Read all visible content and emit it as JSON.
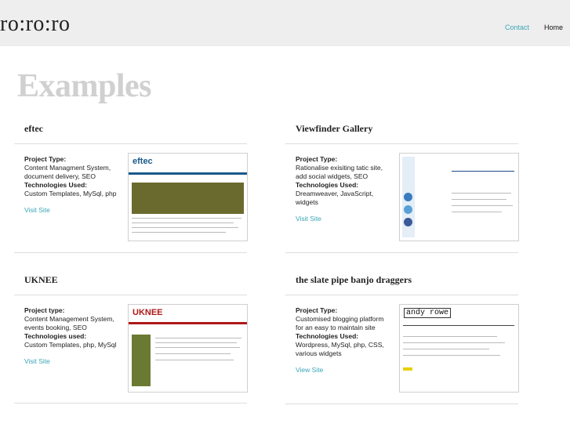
{
  "header": {
    "logo": "ro:ro:ro",
    "nav": {
      "contact": "Contact",
      "home": "Home"
    }
  },
  "page_title": "Examples",
  "projects": [
    {
      "title": "eftec",
      "type_label": "Project Type:",
      "type": "Content Managment System, document delivery, SEO",
      "tech_label": "Technologies Used:",
      "tech": "Custom Templates, MySql, php",
      "visit": "Visit Site",
      "thumb_logo": "eftec"
    },
    {
      "title": "Viewfinder Gallery",
      "type_label": "Project Type:",
      "type": "Rationalise exisiting tatic site, add social widgets, SEO",
      "tech_label": "Technologies Used:",
      "tech": "Dreamweaver, JavaScript, widgets",
      "visit": "Visit Site",
      "thumb_logo": ""
    },
    {
      "title": "UKNEE",
      "type_label": "Project type:",
      "type": "Content Management System, events booking, SEO",
      "tech_label": "Technologies used:",
      "tech": "Custom Templates, php, MySql",
      "visit": "Visit Site",
      "thumb_logo": "UKNEE"
    },
    {
      "title": "the slate pipe banjo draggers",
      "type_label": "Project Type:",
      "type": "Customised blogging platform for an easy to maintain site",
      "tech_label": "Technologies Used:",
      "tech": "Wordpress, MySql, php, CSS, various widgets",
      "visit": "View Site",
      "thumb_logo": "andy rowe"
    }
  ],
  "colors": {
    "accent": "#3aa6b8",
    "header_bg": "#eeeeee",
    "title_gray": "#d0d0d0"
  }
}
